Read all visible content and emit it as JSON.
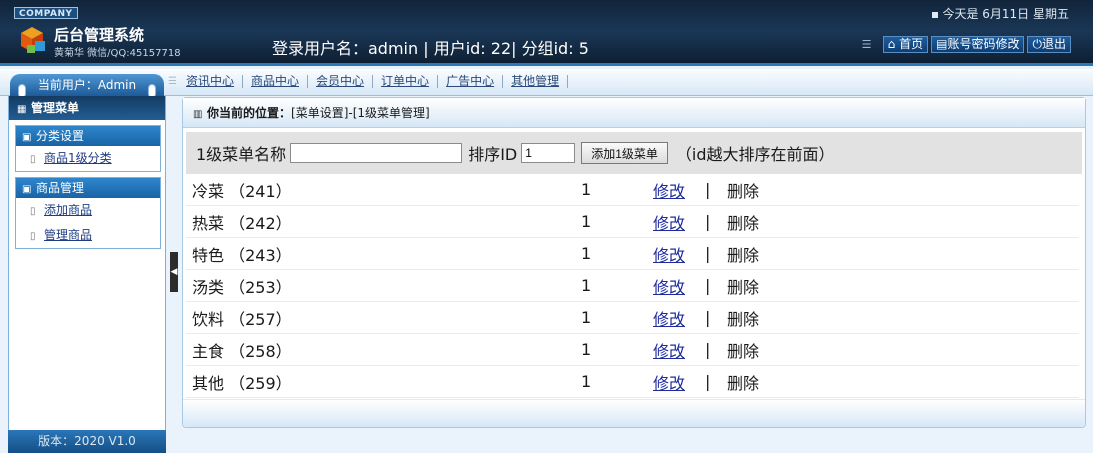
{
  "header": {
    "company": "COMPANY",
    "system_title": "后台管理系统",
    "subtitle": "黄菊华 微信/QQ:45157718",
    "login_info": "登录用户名：admin | 用户id: 22| 分组id: 5",
    "date_text": "今天是 6月11日 星期五",
    "buttons": {
      "home": "首页",
      "account": "账号密码修改",
      "logout": "退出"
    }
  },
  "nav": {
    "current_user": "当前用户：Admin",
    "links": [
      "资讯中心",
      "商品中心",
      "会员中心",
      "订单中心",
      "广告中心",
      "其他管理"
    ]
  },
  "sidebar": {
    "head": "管理菜单",
    "groups": [
      {
        "title": "分类设置",
        "items": [
          "商品1级分类"
        ]
      },
      {
        "title": "商品管理",
        "items": [
          "添加商品",
          "管理商品"
        ]
      }
    ],
    "version": "版本：2020 V1.0"
  },
  "main": {
    "crumb_label": "你当前的位置：",
    "crumb_path": "[菜单设置]-[1级菜单管理]",
    "form": {
      "name_label": "1级菜单名称",
      "name_value": "",
      "sort_label": "排序ID",
      "sort_value": "1",
      "add_button": "添加1级菜单",
      "hint": "（id越大排序在前面）"
    },
    "rows": [
      {
        "name": "冷菜 （241）",
        "sort": "1",
        "edit": "修改",
        "sep": "|",
        "del": "删除"
      },
      {
        "name": "热菜 （242）",
        "sort": "1",
        "edit": "修改",
        "sep": "|",
        "del": "删除"
      },
      {
        "name": "特色 （243）",
        "sort": "1",
        "edit": "修改",
        "sep": "|",
        "del": "删除"
      },
      {
        "name": "汤类 （253）",
        "sort": "1",
        "edit": "修改",
        "sep": "|",
        "del": "删除"
      },
      {
        "name": "饮料 （257）",
        "sort": "1",
        "edit": "修改",
        "sep": "|",
        "del": "删除"
      },
      {
        "name": "主食 （258）",
        "sort": "1",
        "edit": "修改",
        "sep": "|",
        "del": "删除"
      },
      {
        "name": "其他 （259）",
        "sort": "1",
        "edit": "修改",
        "sep": "|",
        "del": "删除"
      }
    ]
  }
}
